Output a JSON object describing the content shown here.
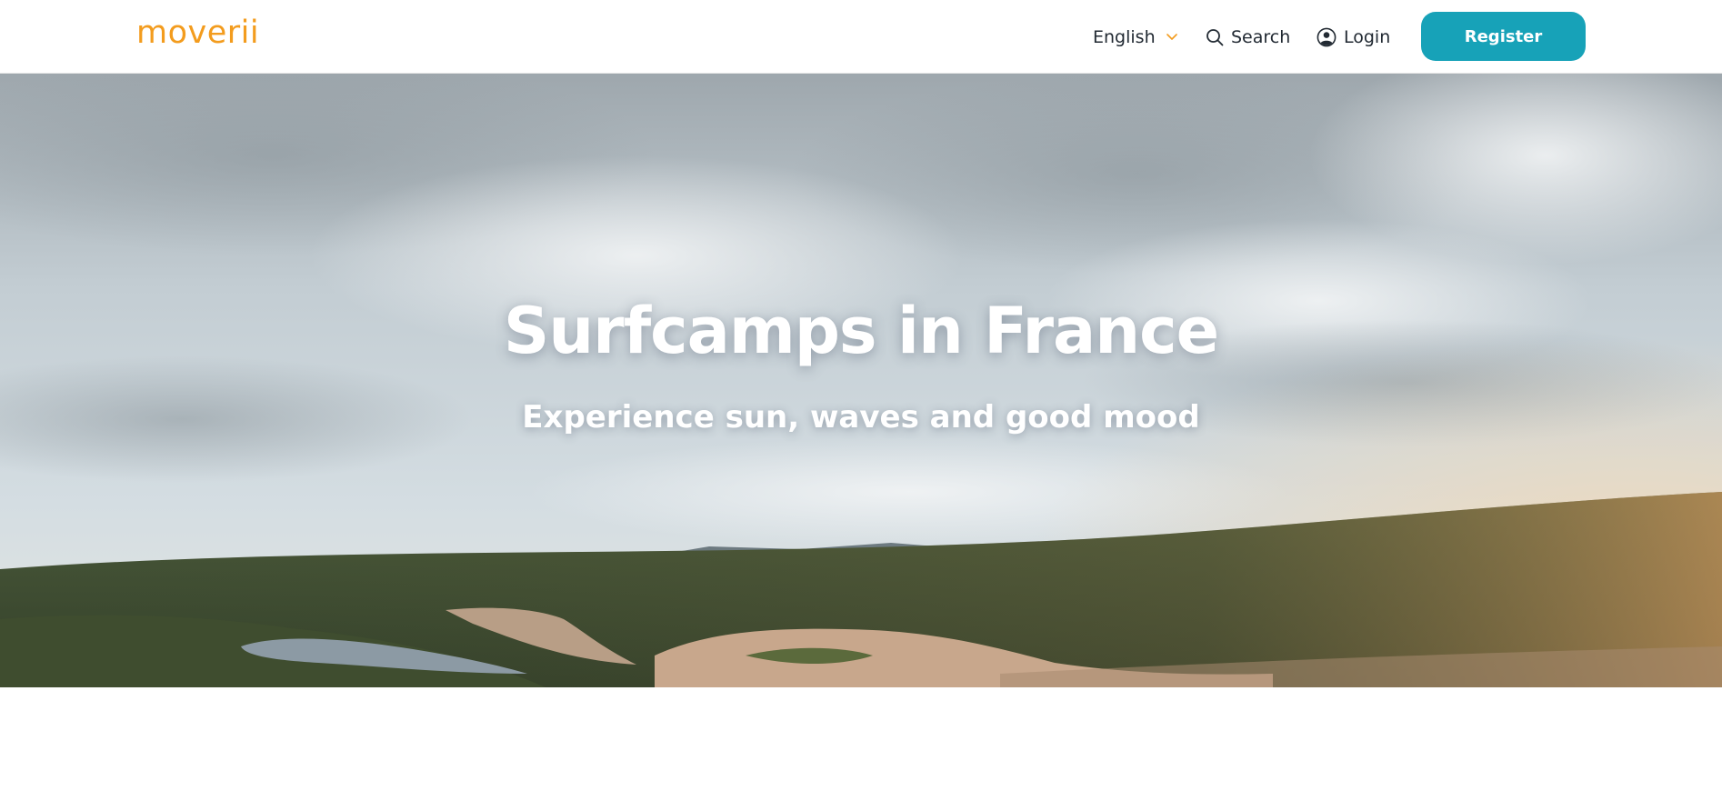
{
  "header": {
    "logo_text": "moverii",
    "logo_color": "#f39c1e",
    "logo_accent_color": "#1aa6bd",
    "language": {
      "label": "English",
      "icon": "chevron-down-icon"
    },
    "search": {
      "label": "Search",
      "icon": "search-icon"
    },
    "login": {
      "label": "Login",
      "icon": "user-circle-icon"
    },
    "register": {
      "label": "Register",
      "color": "#17a2b8"
    }
  },
  "hero": {
    "title": "Surfcamps in France",
    "subtitle": "Experience sun, waves and good mood",
    "image": "landscape-photo"
  }
}
